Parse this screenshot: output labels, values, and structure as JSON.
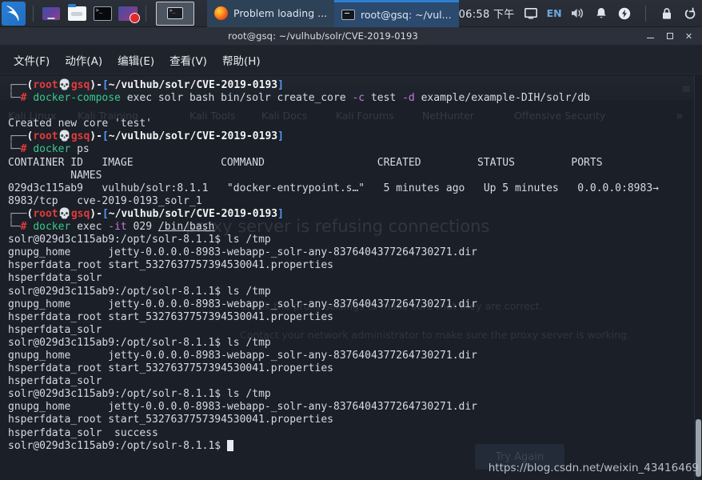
{
  "taskbar": {
    "launchers": [
      {
        "name": "kali-menu-icon",
        "label": "Kali Menu"
      },
      {
        "name": "workspace-switcher-icon",
        "label": "Workspace"
      },
      {
        "name": "file-manager-icon",
        "label": "File Manager"
      },
      {
        "name": "terminal-icon",
        "label": "Terminal"
      },
      {
        "name": "screen-recorder-icon",
        "label": "Screen Recorder"
      }
    ],
    "active_window_icon": "terminal-window-icon",
    "tasks": [
      {
        "icon": "firefox-icon",
        "label": "Problem loading ...",
        "active": false
      },
      {
        "icon": "terminal-icon",
        "label": "root@gsq: ~/vul...",
        "active": true
      }
    ],
    "clock": "06:58 下午",
    "display_icon": "display-icon",
    "keyboard_layout": "EN",
    "volume_icon": "volume-icon",
    "notification_icon": "bell-icon",
    "power_icon": "power-icon",
    "lock_icon": "lock-icon",
    "logout_icon": "logout-icon"
  },
  "window": {
    "title": "root@gsq: ~/vulhub/solr/CVE-2019-0193",
    "minimize_label": "",
    "maximize_label": "",
    "close_label": "✕",
    "menus": [
      {
        "label": "文件(F)"
      },
      {
        "label": "动作(A)"
      },
      {
        "label": "编辑(E)"
      },
      {
        "label": "查看(V)"
      },
      {
        "label": "帮助(H)"
      }
    ]
  },
  "terminal": {
    "prompt": {
      "user": "root",
      "skull": "💀",
      "host": "gsq",
      "path": "~/vulhub/solr/CVE-2019-0193",
      "sigil": "#"
    },
    "container_prompt": "solr@029d3c115ab9:/opt/solr-8.1.1$",
    "blocks": [
      {
        "type": "prompt",
        "command_parts": [
          {
            "text": "docker-compose",
            "color": "green"
          },
          {
            "text": " exec solr bash bin/solr create_core ",
            "color": "plain"
          },
          {
            "text": "-c",
            "color": "magenta"
          },
          {
            "text": " test ",
            "color": "plain"
          },
          {
            "text": "-d",
            "color": "magenta"
          },
          {
            "text": " example/example-DIH/solr/db",
            "color": "plain"
          }
        ],
        "output": [
          "",
          "Created new core 'test'"
        ]
      },
      {
        "type": "prompt",
        "command_parts": [
          {
            "text": "docker",
            "color": "green"
          },
          {
            "text": " ps",
            "color": "plain"
          }
        ],
        "output": [
          "CONTAINER ID   IMAGE              COMMAND                  CREATED         STATUS         PORTS",
          "          NAMES",
          "029d3c115ab9   vulhub/solr:8.1.1   \"docker-entrypoint.s…\"   5 minutes ago   Up 5 minutes   0.0.0.0:8983→",
          "8983/tcp   cve-2019-0193_solr_1"
        ]
      },
      {
        "type": "prompt",
        "command_parts": [
          {
            "text": "docker",
            "color": "green"
          },
          {
            "text": " exec ",
            "color": "plain"
          },
          {
            "text": "-it",
            "color": "magenta"
          },
          {
            "text": " 029 ",
            "color": "plain"
          },
          {
            "text": "/bin/bash",
            "color": "underline"
          }
        ],
        "output": []
      }
    ],
    "ls_command": "ls /tmp",
    "ls_output_rows": [
      [
        "gnupg_home",
        "jetty-0.0.0.0-8983-webapp-_solr-any-8376404377264730271.dir"
      ],
      [
        "hsperfdata_root",
        "start_5327637757394530041.properties"
      ],
      [
        "hsperfdata_solr",
        ""
      ]
    ],
    "ls_repeats": 4,
    "final_extra": "success",
    "cursor": "block"
  },
  "ghost_page": {
    "bookmarks": [
      "Kali Linux",
      "Kali Training",
      "Kali Tools",
      "Kali Docs",
      "Kali Forums",
      "NetHunter",
      "Offensive Security"
    ],
    "overflow_icon": "chevron-double-right-icon",
    "heading": "proxy server is refusing connections",
    "body_lines": [
      "Check the proxy settings to make sure that they are correct.",
      "Contact your network administrator to make sure the proxy server is working."
    ],
    "button_label": "Try Again"
  },
  "watermark": "https://blog.csdn.net/weixin_43416469",
  "colors": {
    "terminal_bg": "#1b1f27",
    "prompt_red": "#e33b3b",
    "prompt_cyan": "#34b9d0",
    "cmd_green": "#37c98c",
    "flag_magenta": "#c678dd",
    "accent_blue": "#2f7fd1"
  }
}
